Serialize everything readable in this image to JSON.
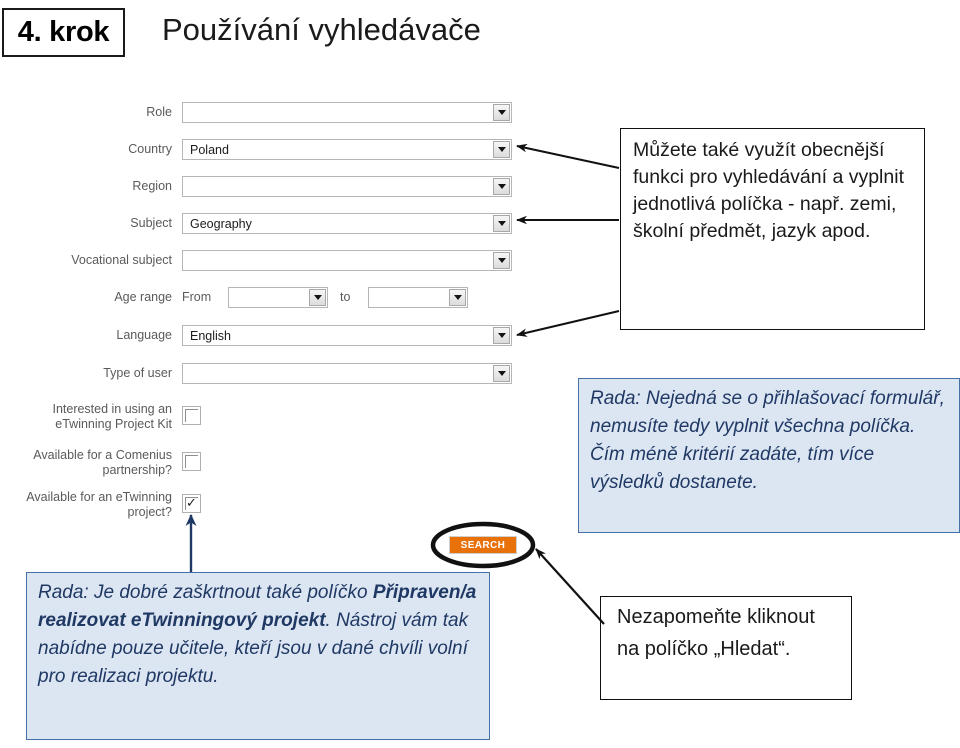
{
  "header": {
    "step_badge": "4. krok",
    "title": "Používání vyhledávače"
  },
  "form": {
    "rows": [
      {
        "label": "Role",
        "value": "",
        "type": "select"
      },
      {
        "label": "Country",
        "value": "Poland",
        "type": "select"
      },
      {
        "label": "Region",
        "value": "",
        "type": "select"
      },
      {
        "label": "Subject",
        "value": "Geography",
        "type": "select"
      },
      {
        "label": "Vocational subject",
        "value": "",
        "type": "select"
      },
      {
        "label": "Age range",
        "value": "",
        "type": "range"
      },
      {
        "label": "Language",
        "value": "English",
        "type": "select"
      },
      {
        "label": "Type of user",
        "value": "",
        "type": "select"
      }
    ],
    "age_range": {
      "from_label": "From",
      "to_label": "to",
      "from_value": "",
      "to_value": ""
    },
    "checkboxes": [
      {
        "label_line1": "Interested in using an",
        "label_line2": "eTwinning Project Kit",
        "checked": false
      },
      {
        "label_line1": "Available for a Comenius",
        "label_line2": "partnership?",
        "checked": false
      },
      {
        "label_line1": "Available for an eTwinning",
        "label_line2": "project?",
        "checked": true
      }
    ],
    "search_button": "SEARCH"
  },
  "callouts": {
    "top": "Můžete také využít obecnější funkci pro vyhledávání a vyplnit jednotlivá políčka - např. zemi, školní předmět, jazyk apod.",
    "tip_right": "Rada: Nejedná se o přihlašovací formulář, nemusíte tedy vyplnit všechna políčka. Čím méně kritérií zadáte, tím více výsledků dostanete.",
    "tip_bottom_prefix": "Rada: Je dobré zaškrtnout také políčko ",
    "tip_bottom_bold": "Připraven/a realizovat eTwinningový projekt",
    "tip_bottom_suffix": ". Nástroj vám tak nabídne pouze učitele, kteří jsou v dané chvíli volní pro realizaci projektu.",
    "bottom_right": "Nezapomeňte kliknout na políčko „Hledat“."
  },
  "colors": {
    "accent_orange": "#e8710a",
    "callout_blue_fill": "#dce6f2",
    "callout_blue_border": "#4472a8",
    "callout_blue_text": "#1f3864",
    "arrow_black": "#111111",
    "arrow_blue": "#1f3864"
  }
}
